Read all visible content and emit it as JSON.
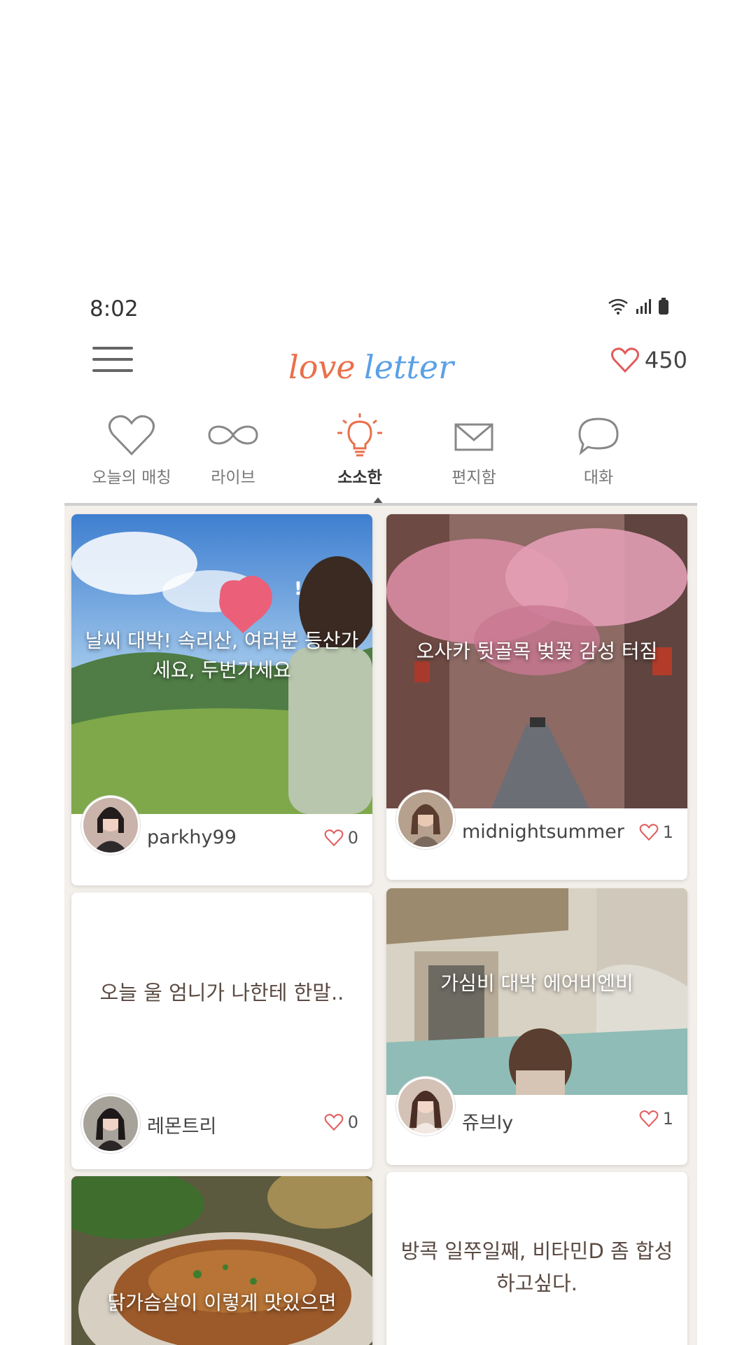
{
  "status_bar": {
    "time": "8:02"
  },
  "header": {
    "logo_word1": "love",
    "logo_word2": "letter",
    "hearts_count": "450"
  },
  "tabs": [
    {
      "label": "오늘의 매칭",
      "icon": "heart-outline-icon"
    },
    {
      "label": "라이브",
      "icon": "infinity-icon"
    },
    {
      "label": "소소한",
      "icon": "lightbulb-icon",
      "active": true
    },
    {
      "label": "편지함",
      "icon": "envelope-icon"
    },
    {
      "label": "대화",
      "icon": "speech-bubble-icon"
    }
  ],
  "cards": [
    {
      "caption": "날씨 대박! 속리산, 여러분 등산가세요, 두번가세요",
      "username": "parkhy99",
      "likes": "0"
    },
    {
      "caption": "오사카 뒷골목 벚꽃 감성 터짐",
      "username": "midnightsummer",
      "likes": "1"
    },
    {
      "text": "오늘 울 엄니가 나한테 한말..",
      "username": "레몬트리",
      "likes": "0"
    },
    {
      "caption": "가심비 대박 에어비엔비",
      "username": "쥬브ly",
      "likes": "1"
    },
    {
      "caption": "닭가슴살이 이렇게 맛있으면"
    },
    {
      "text": "방콕 일쭈일째, 비타민D 좀 합성하고싶다."
    }
  ],
  "colors": {
    "accent": "#ea6f4a",
    "logo_blue": "#5aa0e6",
    "heart": "#e25b5b",
    "active_tab": "#333333"
  }
}
